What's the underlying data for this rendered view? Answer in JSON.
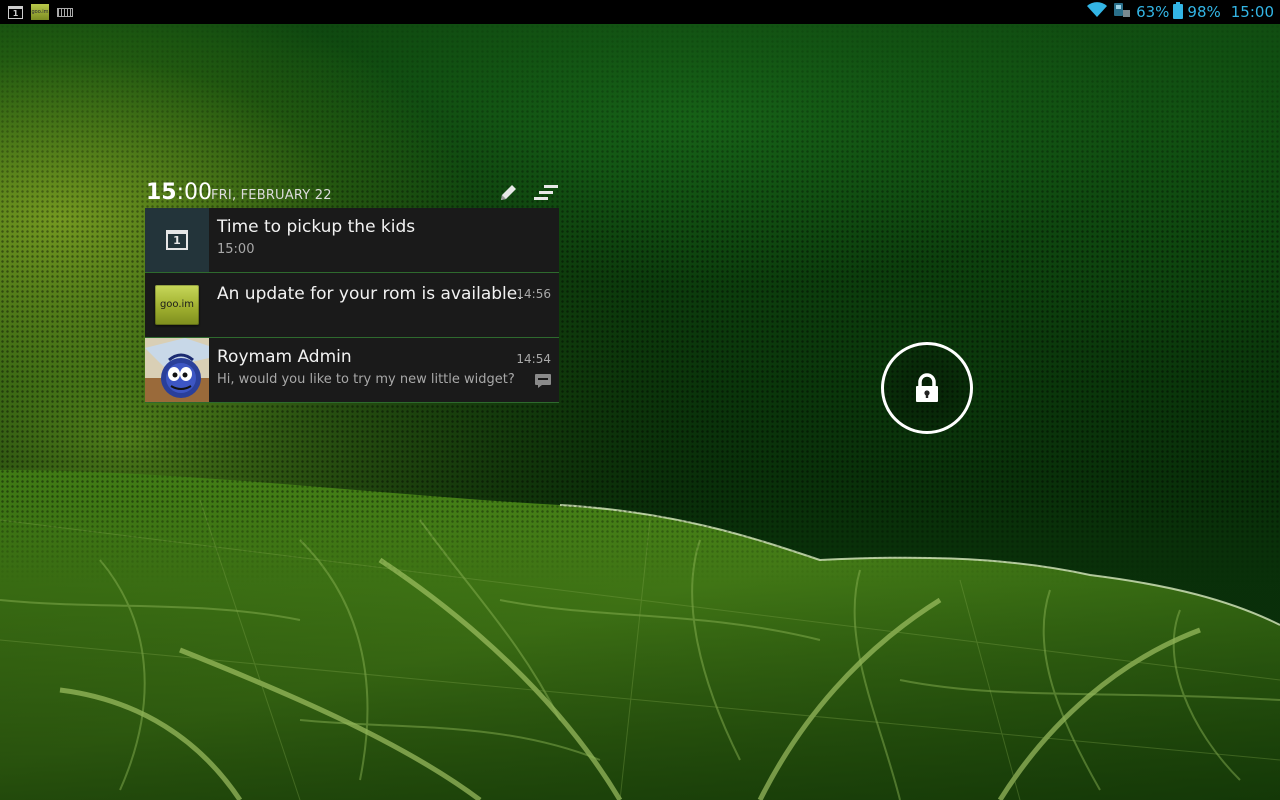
{
  "status_bar": {
    "left_icons": [
      "calendar-icon",
      "goo-im-icon",
      "keyboard-icon"
    ],
    "calendar_day": "1",
    "goo_label": "goo.im",
    "wifi_icon": "wifi-icon",
    "sim_icon": "sim-card-icon",
    "signal_percent": "63%",
    "battery_icon": "battery-icon",
    "battery_percent": "98%",
    "time": "15:00",
    "accent_color": "#33b5e5"
  },
  "widget": {
    "clock_hours": "15",
    "clock_minutes": ":00",
    "date": "FRI, FEBRUARY 22",
    "edit_icon": "pencil-icon",
    "list_icon": "clear-list-icon",
    "notifications": [
      {
        "icon": "calendar-icon",
        "icon_text": "1",
        "title": "Time to pickup the kids",
        "subtitle": "15:00",
        "time": ""
      },
      {
        "icon": "goo-im-icon",
        "icon_text": "goo.im",
        "title": "An update for your rom is available.",
        "subtitle": "",
        "time": "14:56"
      },
      {
        "icon": "avatar",
        "title": "Roymam Admin",
        "subtitle": "Hi, would you like to try my new little widget?",
        "time": "14:54",
        "badge_icon": "sms-icon"
      }
    ]
  },
  "lockscreen": {
    "unlock_icon": "lock-icon"
  }
}
